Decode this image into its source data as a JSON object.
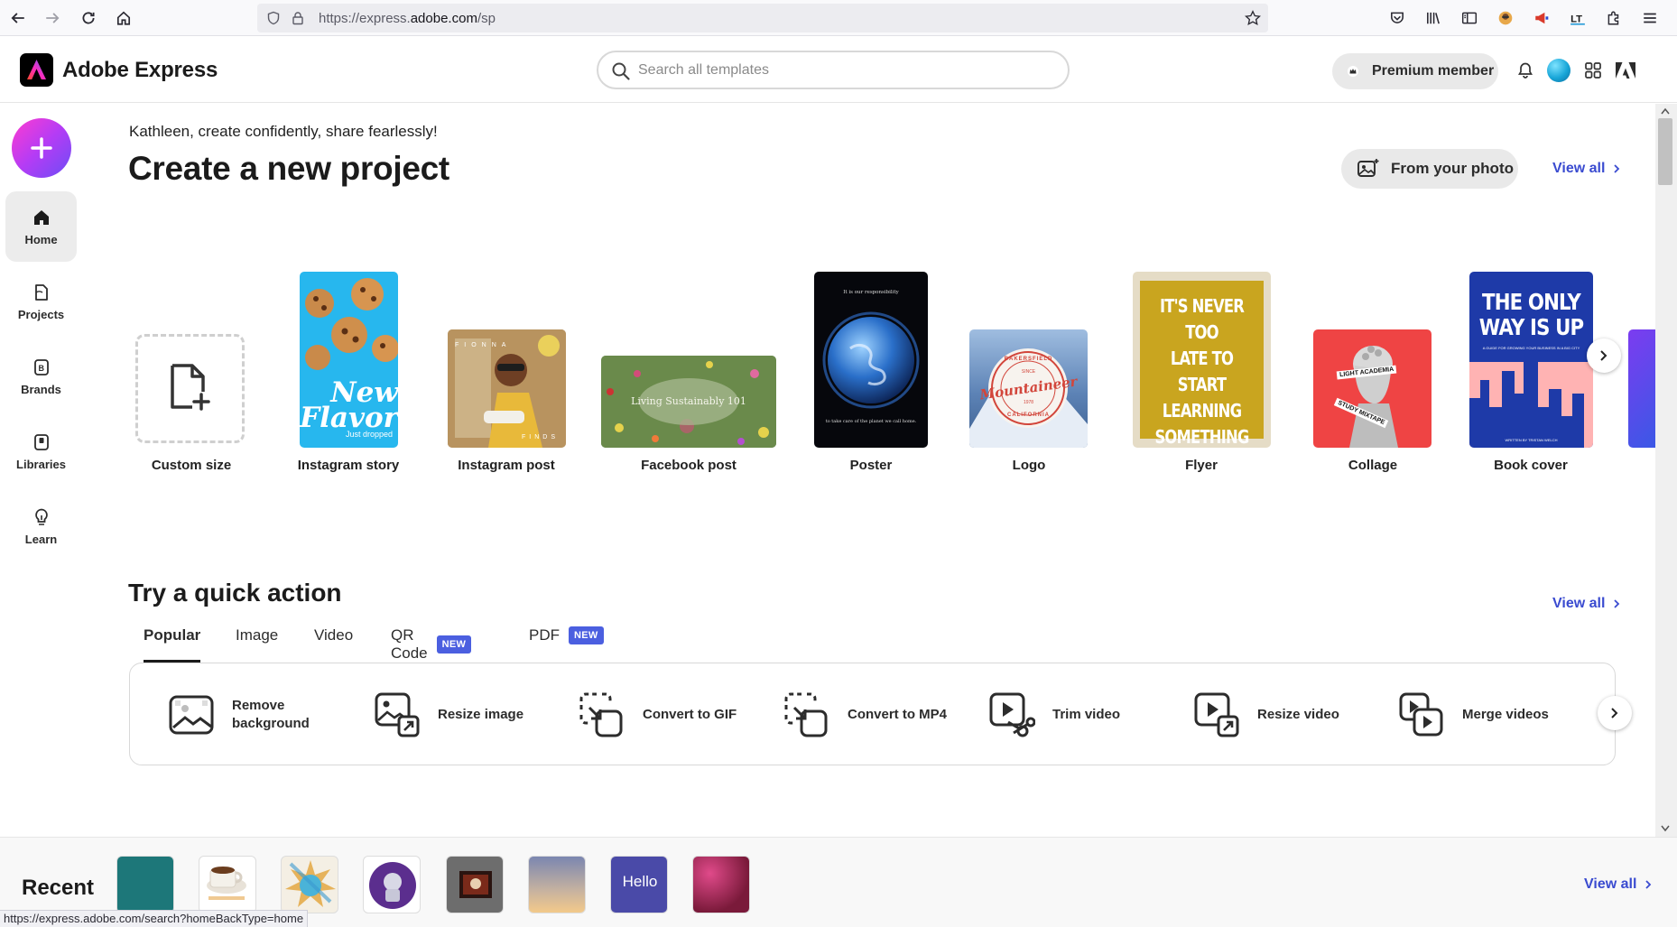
{
  "browser": {
    "url": "https://express.adobe.com/sp",
    "url_prefix": "https://express.",
    "url_domain": "adobe.com",
    "url_suffix": "/sp",
    "status_url": "https://express.adobe.com/search?homeBackType=home"
  },
  "header": {
    "app_name": "Adobe Express",
    "search_placeholder": "Search all templates",
    "premium_label": "Premium member"
  },
  "rail": {
    "items": [
      {
        "label": "Home",
        "icon": "home-icon"
      },
      {
        "label": "Projects",
        "icon": "projects-icon"
      },
      {
        "label": "Brands",
        "icon": "brands-icon"
      },
      {
        "label": "Libraries",
        "icon": "libraries-icon"
      },
      {
        "label": "Learn",
        "icon": "lightbulb-icon"
      }
    ]
  },
  "main": {
    "greeting": "Kathleen, create confidently, share fearlessly!",
    "title": "Create a new project",
    "from_photo": "From your photo",
    "view_all": "View all",
    "templates": [
      {
        "label": "Custom size"
      },
      {
        "label": "Instagram story",
        "art": "New Flavor",
        "art_sub": "Just dropped"
      },
      {
        "label": "Instagram post",
        "art": "FIONNA",
        "art_sub": "FINDS"
      },
      {
        "label": "Facebook post",
        "art": "Living Sustainably 101"
      },
      {
        "label": "Poster",
        "art": "It is our responsibility",
        "art_sub": "to take care of the planet we call home."
      },
      {
        "label": "Logo",
        "art": "Mountaineer",
        "art_top": "BAKERSFIELD",
        "art_since": "SINCE",
        "art_year": "1978",
        "art_bottom": "CALIFORNIA"
      },
      {
        "label": "Flyer",
        "art": [
          "IT'S NEVER TOO",
          "LATE TO",
          "START",
          "LEARNING",
          "SOMETHING NEW"
        ]
      },
      {
        "label": "Collage",
        "art": "LIGHT ACADEMIA",
        "art_sub": "STUDY MIXTAPE"
      },
      {
        "label": "Book cover",
        "art": [
          "THE ONLY",
          "WAY IS UP"
        ],
        "art_sub": "A GUIDE FOR GROWING YOUR BUSINESS IN A BIG CITY",
        "art_author": "WRITTEN BY TRISTAN WELCH"
      }
    ]
  },
  "quick_action": {
    "title": "Try a quick action",
    "view_all": "View all",
    "tabs": [
      {
        "label": "Popular",
        "badge": ""
      },
      {
        "label": "Image",
        "badge": ""
      },
      {
        "label": "Video",
        "badge": ""
      },
      {
        "label": "QR Code",
        "badge": "NEW"
      },
      {
        "label": "PDF",
        "badge": "NEW"
      }
    ],
    "actions": [
      {
        "label": "Remove background",
        "icon": "remove-background-icon"
      },
      {
        "label": "Resize image",
        "icon": "resize-image-icon"
      },
      {
        "label": "Convert to GIF",
        "icon": "convert-gif-icon"
      },
      {
        "label": "Convert to MP4",
        "icon": "convert-mp4-icon"
      },
      {
        "label": "Trim video",
        "icon": "trim-video-icon"
      },
      {
        "label": "Resize video",
        "icon": "resize-video-icon"
      },
      {
        "label": "Merge videos",
        "icon": "merge-videos-icon"
      }
    ]
  },
  "recent": {
    "title": "Recent",
    "view_all": "View all",
    "thumb_text": "Hello",
    "items_count": 8
  },
  "colors": {
    "accent": "#3a4bd0",
    "badge": "#4b5fe0",
    "create_gradient": [
      "#ff3bd0",
      "#6c4df5"
    ]
  }
}
